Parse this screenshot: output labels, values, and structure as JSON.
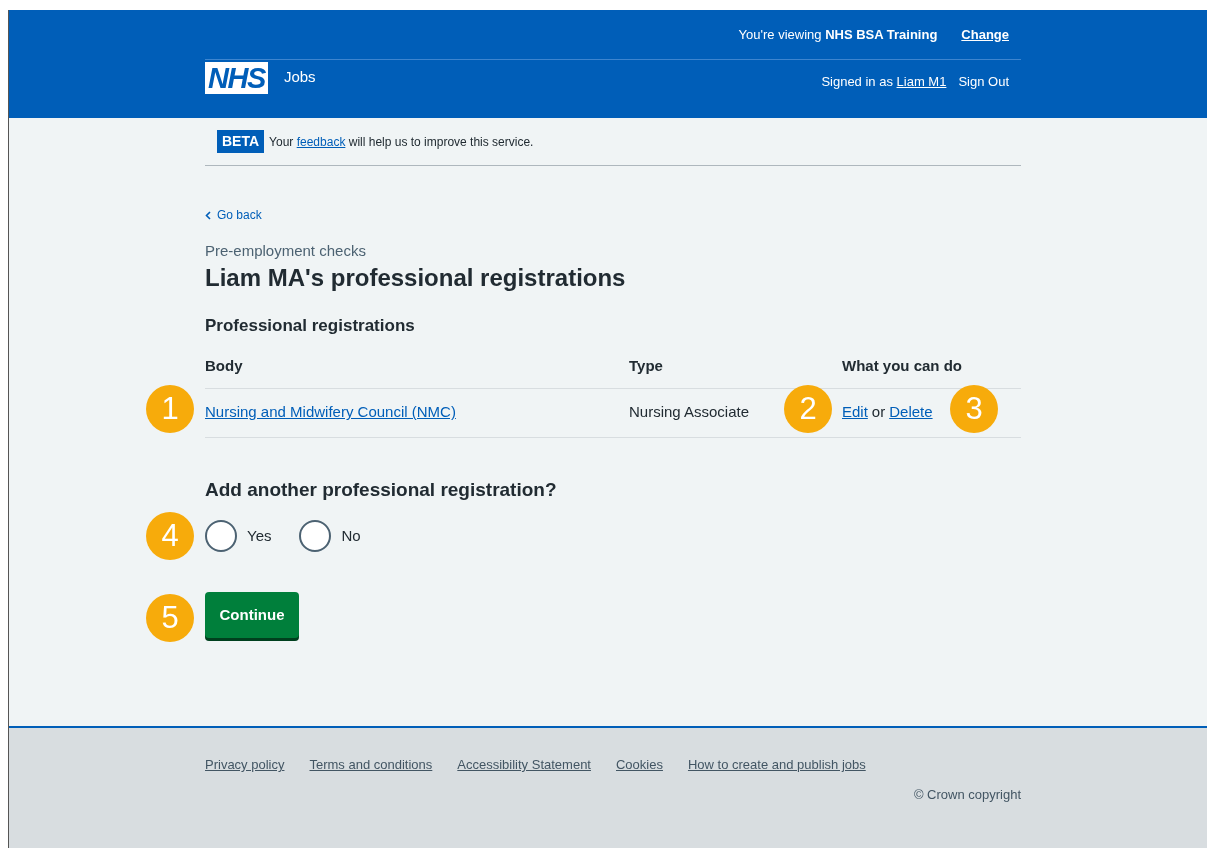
{
  "header": {
    "logo": "NHS",
    "service": "Jobs",
    "viewing_prefix": "You're viewing ",
    "viewing_org": "NHS BSA Training",
    "change_link": "Change",
    "signed_in_prefix": "Signed in as ",
    "user_link": "Liam M1",
    "sign_out": "Sign Out"
  },
  "beta_banner": {
    "tag": "BETA",
    "before": "Your ",
    "link": "feedback",
    "after": " will help us to improve this service."
  },
  "back_link": "Go back",
  "caption": "Pre-employment checks",
  "title": "Liam MA's professional registrations",
  "table": {
    "heading": "Professional registrations",
    "columns": [
      "Body",
      "Type",
      "What you can do"
    ],
    "rows": [
      {
        "body": "Nursing and Midwifery Council (NMC)",
        "type": "Nursing Associate",
        "edit": "Edit",
        "or": "or",
        "delete": "Delete"
      }
    ]
  },
  "question": {
    "legend": "Add another professional registration?",
    "options": [
      {
        "label": "Yes",
        "selected": false
      },
      {
        "label": "No",
        "selected": false
      }
    ]
  },
  "continue_button": "Continue",
  "callouts": [
    "1",
    "2",
    "3",
    "4",
    "5"
  ],
  "footer": {
    "links": [
      "Privacy policy",
      "Terms and conditions",
      "Accessibility Statement",
      "Cookies",
      "How to create and publish jobs"
    ],
    "copyright": "© Crown copyright"
  }
}
